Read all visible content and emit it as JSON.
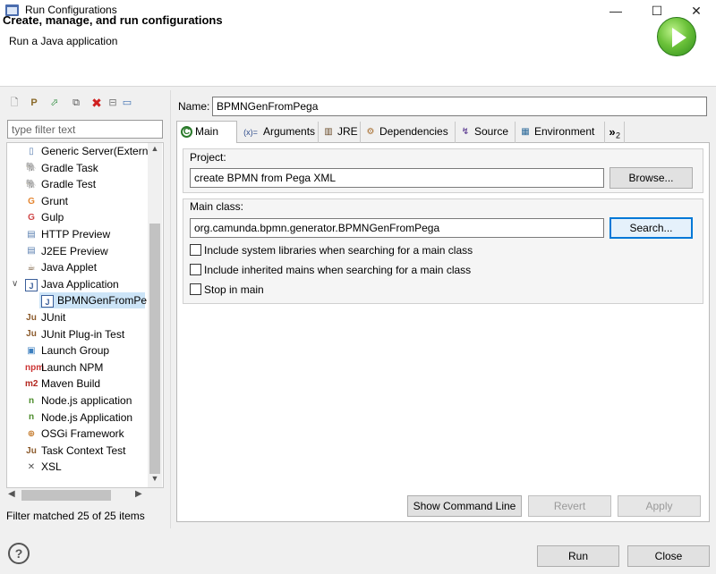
{
  "window": {
    "title": "Run Configurations",
    "controls": {
      "minimize": "—",
      "maximize": "☐",
      "close": "✕"
    }
  },
  "banner": {
    "title": "Create, manage, and run configurations",
    "subtitle": "Run a Java application",
    "icon": "run-green-circle-icon"
  },
  "toolbar": {
    "icons": [
      "new-configuration-icon",
      "new-prototype-icon",
      "export-icon",
      "duplicate-icon",
      "delete-icon",
      "collapse-all-icon",
      "filter-icon"
    ]
  },
  "filter": {
    "placeholder": "type filter text",
    "status": "Filter matched 25 of 25 items"
  },
  "tree": {
    "items": [
      {
        "label": "Generic Server(Extern",
        "icon": "server-icon",
        "glyph": "▯",
        "color": "#5a7fb0"
      },
      {
        "label": "Gradle Task",
        "icon": "gradle-icon",
        "glyph": "🐘",
        "color": "#1c4a5a"
      },
      {
        "label": "Gradle Test",
        "icon": "gradle-icon",
        "glyph": "🐘",
        "color": "#1c4a5a"
      },
      {
        "label": "Grunt",
        "icon": "grunt-icon",
        "glyph": "G",
        "color": "#e48632"
      },
      {
        "label": "Gulp",
        "icon": "gulp-icon",
        "glyph": "G",
        "color": "#cf4647"
      },
      {
        "label": "HTTP Preview",
        "icon": "http-preview-icon",
        "glyph": "▤",
        "color": "#5a7fb0"
      },
      {
        "label": "J2EE Preview",
        "icon": "j2ee-preview-icon",
        "glyph": "▤",
        "color": "#5a7fb0"
      },
      {
        "label": "Java Applet",
        "icon": "java-applet-icon",
        "glyph": "☕",
        "color": "#6b4c2a"
      },
      {
        "label": "Java Application",
        "icon": "java-application-icon",
        "glyph": "J",
        "color": "#3b5f9a"
      },
      {
        "label": "BPMNGenFromPe",
        "icon": "java-class-icon",
        "glyph": "J",
        "color": "#3b5f9a"
      },
      {
        "label": "JUnit",
        "icon": "junit-icon",
        "glyph": "Ju",
        "color": "#8b5a2b"
      },
      {
        "label": "JUnit Plug-in Test",
        "icon": "junit-plugin-icon",
        "glyph": "Ju",
        "color": "#8b5a2b"
      },
      {
        "label": "Launch Group",
        "icon": "launch-group-icon",
        "glyph": "▣",
        "color": "#3c7fbf"
      },
      {
        "label": "Launch NPM",
        "icon": "npm-icon",
        "glyph": "npm",
        "color": "#c33"
      },
      {
        "label": "Maven Build",
        "icon": "maven-icon",
        "glyph": "m2",
        "color": "#b3261e"
      },
      {
        "label": "Node.js application",
        "icon": "nodejs-icon",
        "glyph": "n",
        "color": "#4c8c2b"
      },
      {
        "label": "Node.js Application",
        "icon": "nodejs-icon",
        "glyph": "n",
        "color": "#4c8c2b"
      },
      {
        "label": "OSGi Framework",
        "icon": "osgi-icon",
        "glyph": "⊕",
        "color": "#c47a2b"
      },
      {
        "label": "Task Context Test",
        "icon": "task-context-icon",
        "glyph": "Ju",
        "color": "#8b5a2b"
      },
      {
        "label": "XSL",
        "icon": "xsl-icon",
        "glyph": "✕",
        "color": "#555"
      }
    ]
  },
  "form": {
    "name_label": "Name:",
    "name_value": "BPMNGenFromPega",
    "tabs": [
      {
        "label": "Main",
        "icon": "main-tab-icon",
        "glyph": "C",
        "color": "#2a7a2a"
      },
      {
        "label": "Arguments",
        "icon": "arguments-icon",
        "glyph": "(x)=",
        "color": "#2c4a8a"
      },
      {
        "label": "JRE",
        "icon": "jre-icon",
        "glyph": "▥",
        "color": "#6b4c2a"
      },
      {
        "label": "Dependencies",
        "icon": "dependencies-icon",
        "glyph": "⚙",
        "color": "#a56a2a"
      },
      {
        "label": "Source",
        "icon": "source-icon",
        "glyph": "↯",
        "color": "#6a4c9a"
      },
      {
        "label": "Environment",
        "icon": "environment-icon",
        "glyph": "▦",
        "color": "#2c6a9a"
      },
      {
        "label": "2",
        "icon": "more-tabs-icon",
        "glyph": "»",
        "color": "#000"
      }
    ],
    "project_label": "Project:",
    "project_value": "create BPMN from Pega XML",
    "browse_label": "Browse...",
    "main_class_label": "Main class:",
    "main_class_value": "org.camunda.bpmn.generator.BPMNGenFromPega",
    "search_label": "Search...",
    "checkboxes": [
      {
        "label": "Include system libraries when searching for a main class",
        "checked": false
      },
      {
        "label": "Include inherited mains when searching for a main class",
        "checked": false
      },
      {
        "label": "Stop in main",
        "checked": false
      }
    ],
    "show_command_line": "Show Command Line",
    "revert": "Revert",
    "apply": "Apply"
  },
  "footer": {
    "help": "?",
    "run": "Run",
    "close": "Close"
  }
}
